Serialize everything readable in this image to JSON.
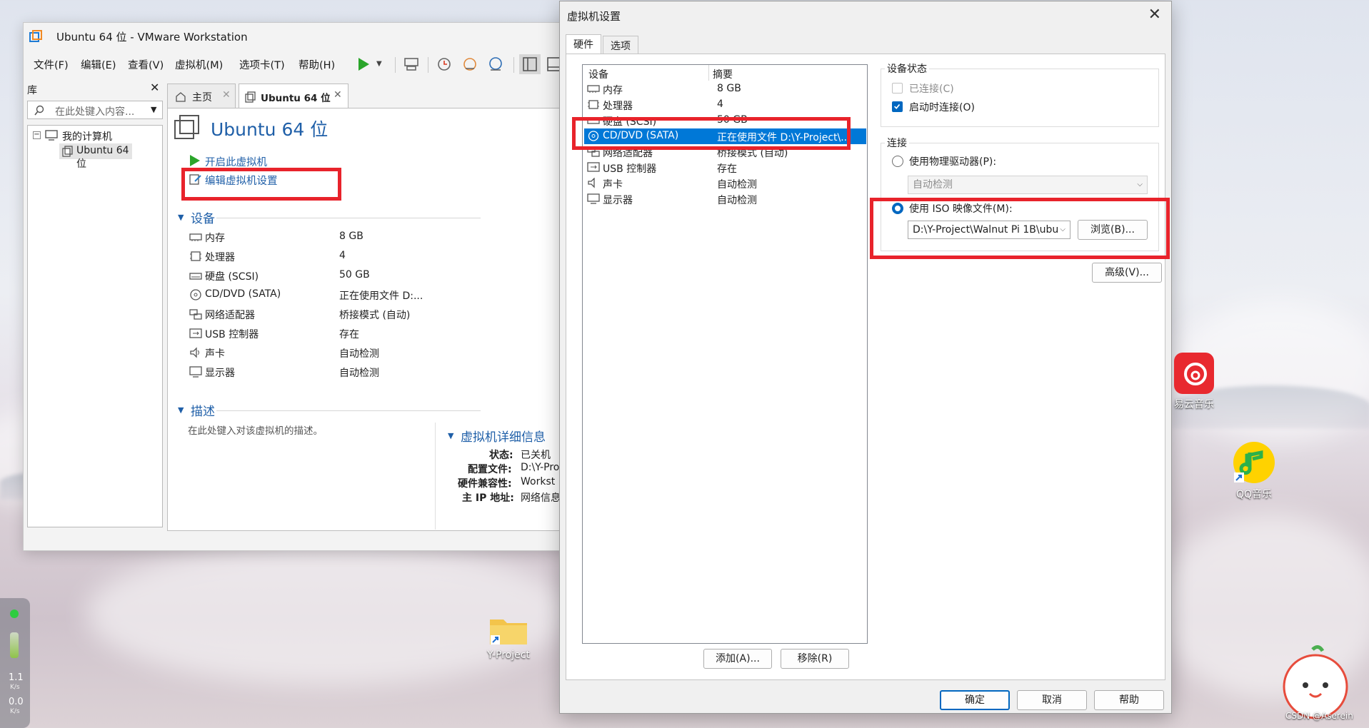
{
  "vmware": {
    "title": "Ubuntu 64 位 - VMware Workstation",
    "menu": [
      "文件(F)",
      "编辑(E)",
      "查看(V)",
      "虚拟机(M)",
      "选项卡(T)",
      "帮助(H)"
    ],
    "library": {
      "title": "库",
      "search_placeholder": "在此处键入内容...",
      "tree_root": "我的计算机",
      "tree_child": "Ubuntu 64 位"
    },
    "tabs": [
      {
        "label": "主页"
      },
      {
        "label": "Ubuntu 64 位"
      }
    ],
    "vm_title": "Ubuntu 64 位",
    "actions": {
      "power_on": "开启此虚拟机",
      "edit_settings": "编辑虚拟机设置"
    },
    "devices_title": "设备",
    "devices": [
      {
        "name": "内存",
        "value": "8 GB",
        "icon": "memory-icon"
      },
      {
        "name": "处理器",
        "value": "4",
        "icon": "cpu-icon"
      },
      {
        "name": "硬盘 (SCSI)",
        "value": "50 GB",
        "icon": "disk-icon"
      },
      {
        "name": "CD/DVD (SATA)",
        "value": "正在使用文件 D:...",
        "icon": "cd-icon"
      },
      {
        "name": "网络适配器",
        "value": "桥接模式 (自动)",
        "icon": "network-icon"
      },
      {
        "name": "USB 控制器",
        "value": "存在",
        "icon": "usb-icon"
      },
      {
        "name": "声卡",
        "value": "自动检测",
        "icon": "sound-icon"
      },
      {
        "name": "显示器",
        "value": "自动检测",
        "icon": "display-icon"
      }
    ],
    "description_title": "描述",
    "description_placeholder": "在此处键入对该虚拟机的描述。",
    "details_title": "虚拟机详细信息",
    "details": [
      {
        "label": "状态:",
        "value": "已关机"
      },
      {
        "label": "配置文件:",
        "value": "D:\\Y-Pro"
      },
      {
        "label": "硬件兼容性:",
        "value": "Workst"
      },
      {
        "label": "主 IP 地址:",
        "value": "网络信息"
      }
    ]
  },
  "dialog": {
    "title": "虚拟机设置",
    "tabs": [
      "硬件",
      "选项"
    ],
    "list_headers": {
      "device": "设备",
      "summary": "摘要"
    },
    "devices": [
      {
        "name": "内存",
        "value": "8 GB",
        "icon": "memory-icon"
      },
      {
        "name": "处理器",
        "value": "4",
        "icon": "cpu-icon"
      },
      {
        "name": "硬盘 (SCSI)",
        "value": "50 GB",
        "icon": "disk-icon"
      },
      {
        "name": "CD/DVD (SATA)",
        "value": "正在使用文件 D:\\Y-Project\\...",
        "icon": "cd-icon",
        "selected": true
      },
      {
        "name": "网络适配器",
        "value": "桥接模式 (自动)",
        "icon": "network-icon"
      },
      {
        "name": "USB 控制器",
        "value": "存在",
        "icon": "usb-icon"
      },
      {
        "name": "声卡",
        "value": "自动检测",
        "icon": "sound-icon"
      },
      {
        "name": "显示器",
        "value": "自动检测",
        "icon": "display-icon"
      }
    ],
    "add_button": "添加(A)...",
    "remove_button": "移除(R)",
    "device_status": {
      "title": "设备状态",
      "connected": "已连接(C)",
      "connected_checked": false,
      "connect_at_power_on": "启动时连接(O)",
      "connect_at_power_on_checked": true
    },
    "connection": {
      "title": "连接",
      "physical_drive": "使用物理驱动器(P):",
      "physical_drive_value": "自动检测",
      "iso_image": "使用 ISO 映像文件(M):",
      "iso_path": "D:\\Y-Project\\Walnut Pi 1B\\ubu",
      "browse_button": "浏览(B)...",
      "selected": "iso"
    },
    "advanced_button": "高级(V)...",
    "ok_button": "确定",
    "cancel_button": "取消",
    "help_button": "帮助"
  },
  "desktop": {
    "icons": [
      {
        "label": "Y-Project"
      },
      {
        "label": "易云音乐"
      },
      {
        "label": "QQ音乐"
      }
    ],
    "net_up": "1.1",
    "net_up_unit": "K/s",
    "net_down": "0.0",
    "net_down_unit": "K/s",
    "watermark": "CSDN @Aserein"
  }
}
